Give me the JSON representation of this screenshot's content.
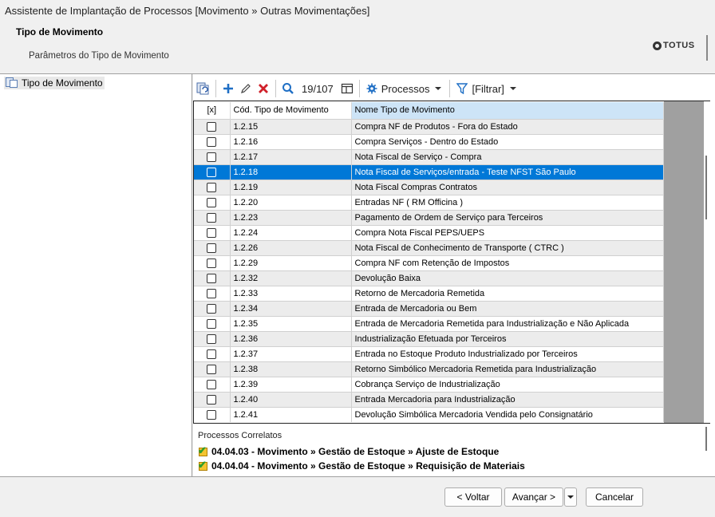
{
  "window": {
    "title": "Assistente de Implantação de Processos [Movimento » Outras Movimentações]"
  },
  "header": {
    "title": "Tipo de Movimento",
    "subtitle": "Parâmetros do Tipo de Movimento",
    "logo": "TOTUS"
  },
  "tree": {
    "items": [
      {
        "label": "Tipo de Movimento"
      }
    ]
  },
  "toolbar": {
    "record_counter": "19/107",
    "processos_label": "Processos",
    "filtrar_label": "[Filtrar]"
  },
  "grid": {
    "columns": [
      "[x]",
      "Cód. Tipo de Movimento",
      "Nome Tipo de Movimento"
    ],
    "selected_index": 3,
    "rows": [
      {
        "cod": "1.2.15",
        "nome": "Compra NF de Produtos - Fora do Estado"
      },
      {
        "cod": "1.2.16",
        "nome": "Compra Serviços - Dentro do Estado"
      },
      {
        "cod": "1.2.17",
        "nome": "Nota Fiscal de Serviço - Compra"
      },
      {
        "cod": "1.2.18",
        "nome": "Nota Fiscal de Serviços/entrada - Teste NFST São Paulo"
      },
      {
        "cod": "1.2.19",
        "nome": "Nota Fiscal Compras Contratos"
      },
      {
        "cod": "1.2.20",
        "nome": "Entradas NF  ( RM Officina )"
      },
      {
        "cod": "1.2.23",
        "nome": "Pagamento de Ordem de Serviço para Terceiros"
      },
      {
        "cod": "1.2.24",
        "nome": "Compra Nota Fiscal PEPS/UEPS"
      },
      {
        "cod": "1.2.26",
        "nome": "Nota Fiscal de Conhecimento de Transporte ( CTRC )"
      },
      {
        "cod": "1.2.29",
        "nome": "Compra NF com Retenção de Impostos"
      },
      {
        "cod": "1.2.32",
        "nome": "Devolução Baixa"
      },
      {
        "cod": "1.2.33",
        "nome": "Retorno de Mercadoria Remetida"
      },
      {
        "cod": "1.2.34",
        "nome": "Entrada de Mercadoria ou Bem"
      },
      {
        "cod": "1.2.35",
        "nome": "Entrada de Mercadoria Remetida para Industrialização e Não Aplicada"
      },
      {
        "cod": "1.2.36",
        "nome": "Industrialização Efetuada por Terceiros"
      },
      {
        "cod": "1.2.37",
        "nome": "Entrada no Estoque Produto Industrializado por Terceiros"
      },
      {
        "cod": "1.2.38",
        "nome": "Retorno Simbólico Mercadoria Remetida para Industrialização"
      },
      {
        "cod": "1.2.39",
        "nome": "Cobrança Serviço de Industrialização"
      },
      {
        "cod": "1.2.40",
        "nome": "Entrada Mercadoria para Industrialização"
      },
      {
        "cod": "1.2.41",
        "nome": "Devolução Simbólica Mercadoria Vendida pelo Consignatário"
      }
    ]
  },
  "processos": {
    "label": "Processos Correlatos",
    "items": [
      "04.04.03 - Movimento » Gestão de Estoque » Ajuste de Estoque",
      "04.04.04 - Movimento » Gestão de Estoque » Requisição de Materiais"
    ]
  },
  "footer": {
    "voltar_label": "< Voltar",
    "avancar_label": "Avançar >",
    "cancelar_label": "Cancelar"
  }
}
